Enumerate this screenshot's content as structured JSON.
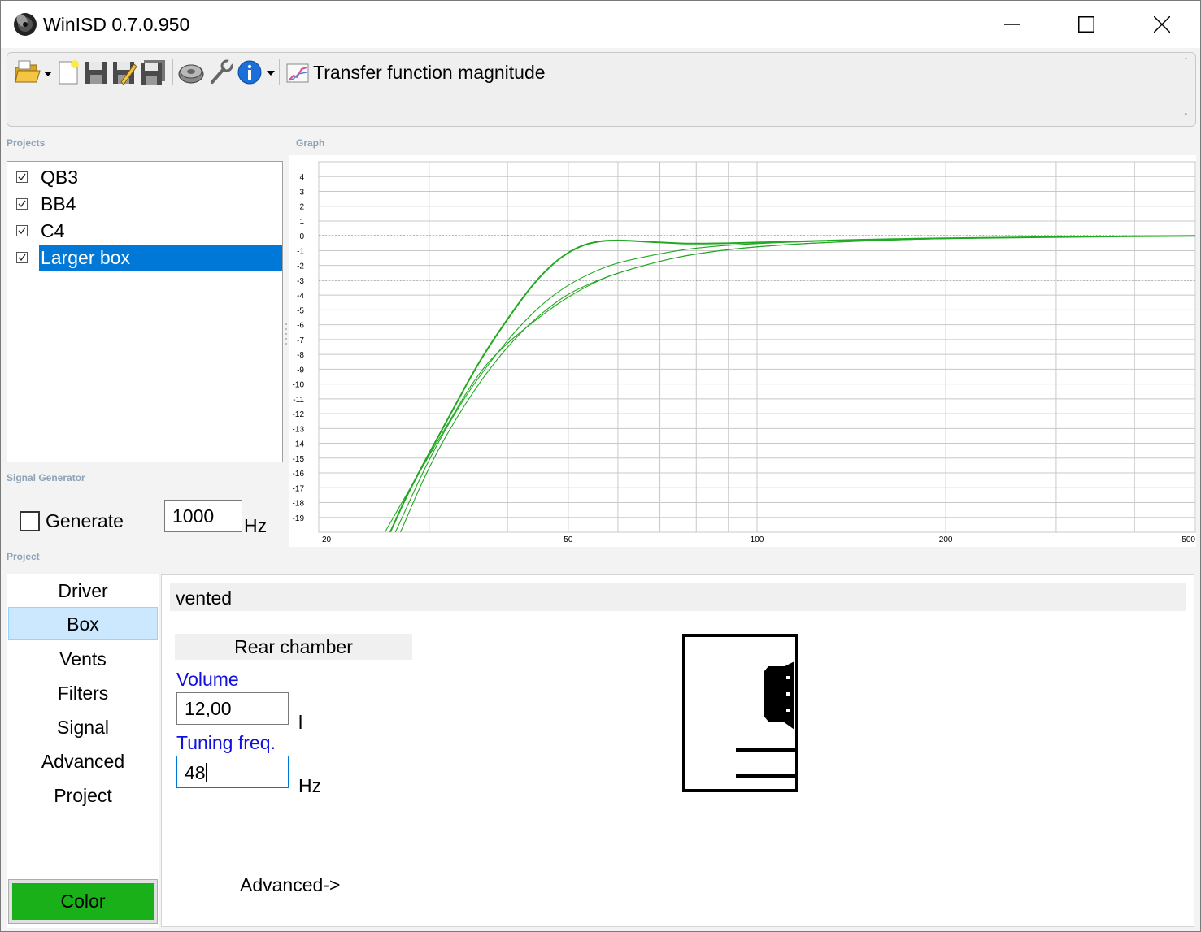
{
  "window": {
    "title": "WinISD 0.7.0.950",
    "controls": [
      "minimize",
      "maximize",
      "close"
    ]
  },
  "toolbar": {
    "icons": [
      "open-folder-icon",
      "new-project-icon",
      "save-icon",
      "save-as-icon",
      "save-all-icon",
      "driver-icon",
      "wrench-icon",
      "info-icon"
    ],
    "graph_title": "Transfer function magnitude"
  },
  "sections": {
    "projects": "Projects",
    "graph": "Graph",
    "signal_generator": "Signal Generator",
    "project": "Project"
  },
  "projects": [
    {
      "name": "QB3",
      "checked": true,
      "selected": false
    },
    {
      "name": "BB4",
      "checked": true,
      "selected": false
    },
    {
      "name": "C4",
      "checked": true,
      "selected": false
    },
    {
      "name": "Larger box",
      "checked": true,
      "selected": true
    }
  ],
  "signal_generator": {
    "generate_label": "Generate",
    "generate_checked": false,
    "frequency": "1000",
    "unit": "Hz"
  },
  "chart_data": {
    "type": "line",
    "xscale": "log",
    "xlim": [
      20,
      500
    ],
    "ylim": [
      -20,
      5
    ],
    "x_ticks": [
      "20",
      "50",
      "100",
      "200",
      "500"
    ],
    "y_ticks": [
      "4",
      "3",
      "2",
      "1",
      "0",
      "-1",
      "-2",
      "-3",
      "-4",
      "-5",
      "-6",
      "-7",
      "-8",
      "-9",
      "-10",
      "-11",
      "-12",
      "-13",
      "-14",
      "-15",
      "-16",
      "-17",
      "-18",
      "-19"
    ],
    "reference_lines": [
      0,
      -3
    ],
    "grid": true,
    "series_color": "#22a822",
    "series": [
      {
        "x": [
          26,
          28,
          32,
          36,
          40,
          44,
          48,
          52,
          56,
          60,
          64,
          70,
          80,
          100,
          150,
          250,
          500
        ],
        "y": [
          -20,
          -17,
          -12.5,
          -8.5,
          -5.6,
          -3.2,
          -1.6,
          -0.7,
          -0.35,
          -0.3,
          -0.35,
          -0.45,
          -0.55,
          -0.45,
          -0.25,
          -0.1,
          0
        ]
      },
      {
        "x": [
          26.5,
          30,
          34,
          38,
          42,
          46,
          50,
          55,
          60,
          70,
          80,
          100,
          150,
          250,
          500
        ],
        "y": [
          -20,
          -15,
          -11,
          -8.2,
          -6,
          -4.4,
          -3.3,
          -2.4,
          -1.8,
          -1.2,
          -0.8,
          -0.5,
          -0.25,
          -0.1,
          0
        ]
      },
      {
        "x": [
          25.5,
          28,
          32,
          36,
          40,
          44,
          48,
          52,
          56,
          60,
          70,
          80,
          100,
          150,
          250,
          500
        ],
        "y": [
          -20,
          -17,
          -12.8,
          -9.2,
          -7.2,
          -5.8,
          -4.6,
          -3.7,
          -3.0,
          -2.5,
          -1.7,
          -1.2,
          -0.7,
          -0.3,
          -0.1,
          0
        ]
      },
      {
        "x": [
          27,
          30,
          34,
          38,
          42,
          46,
          50,
          55,
          60,
          70,
          80,
          100,
          150,
          250,
          500
        ],
        "y": [
          -20,
          -15.5,
          -11.5,
          -8.6,
          -6.5,
          -5,
          -3.9,
          -3.1,
          -2.5,
          -1.7,
          -1.2,
          -0.7,
          -0.3,
          -0.1,
          0
        ]
      }
    ]
  },
  "nav": {
    "items": [
      "Driver",
      "Box",
      "Vents",
      "Filters",
      "Signal",
      "Advanced",
      "Project"
    ],
    "active": "Box",
    "color_button": "Color",
    "color_value": "#1ab01a"
  },
  "box": {
    "type": "vented",
    "chamber": "Rear chamber",
    "volume_label": "Volume",
    "volume_value": "12,00",
    "volume_unit": "l",
    "tuning_label": "Tuning freq.",
    "tuning_value": "48",
    "tuning_unit": "Hz",
    "advanced_link": "Advanced->"
  }
}
